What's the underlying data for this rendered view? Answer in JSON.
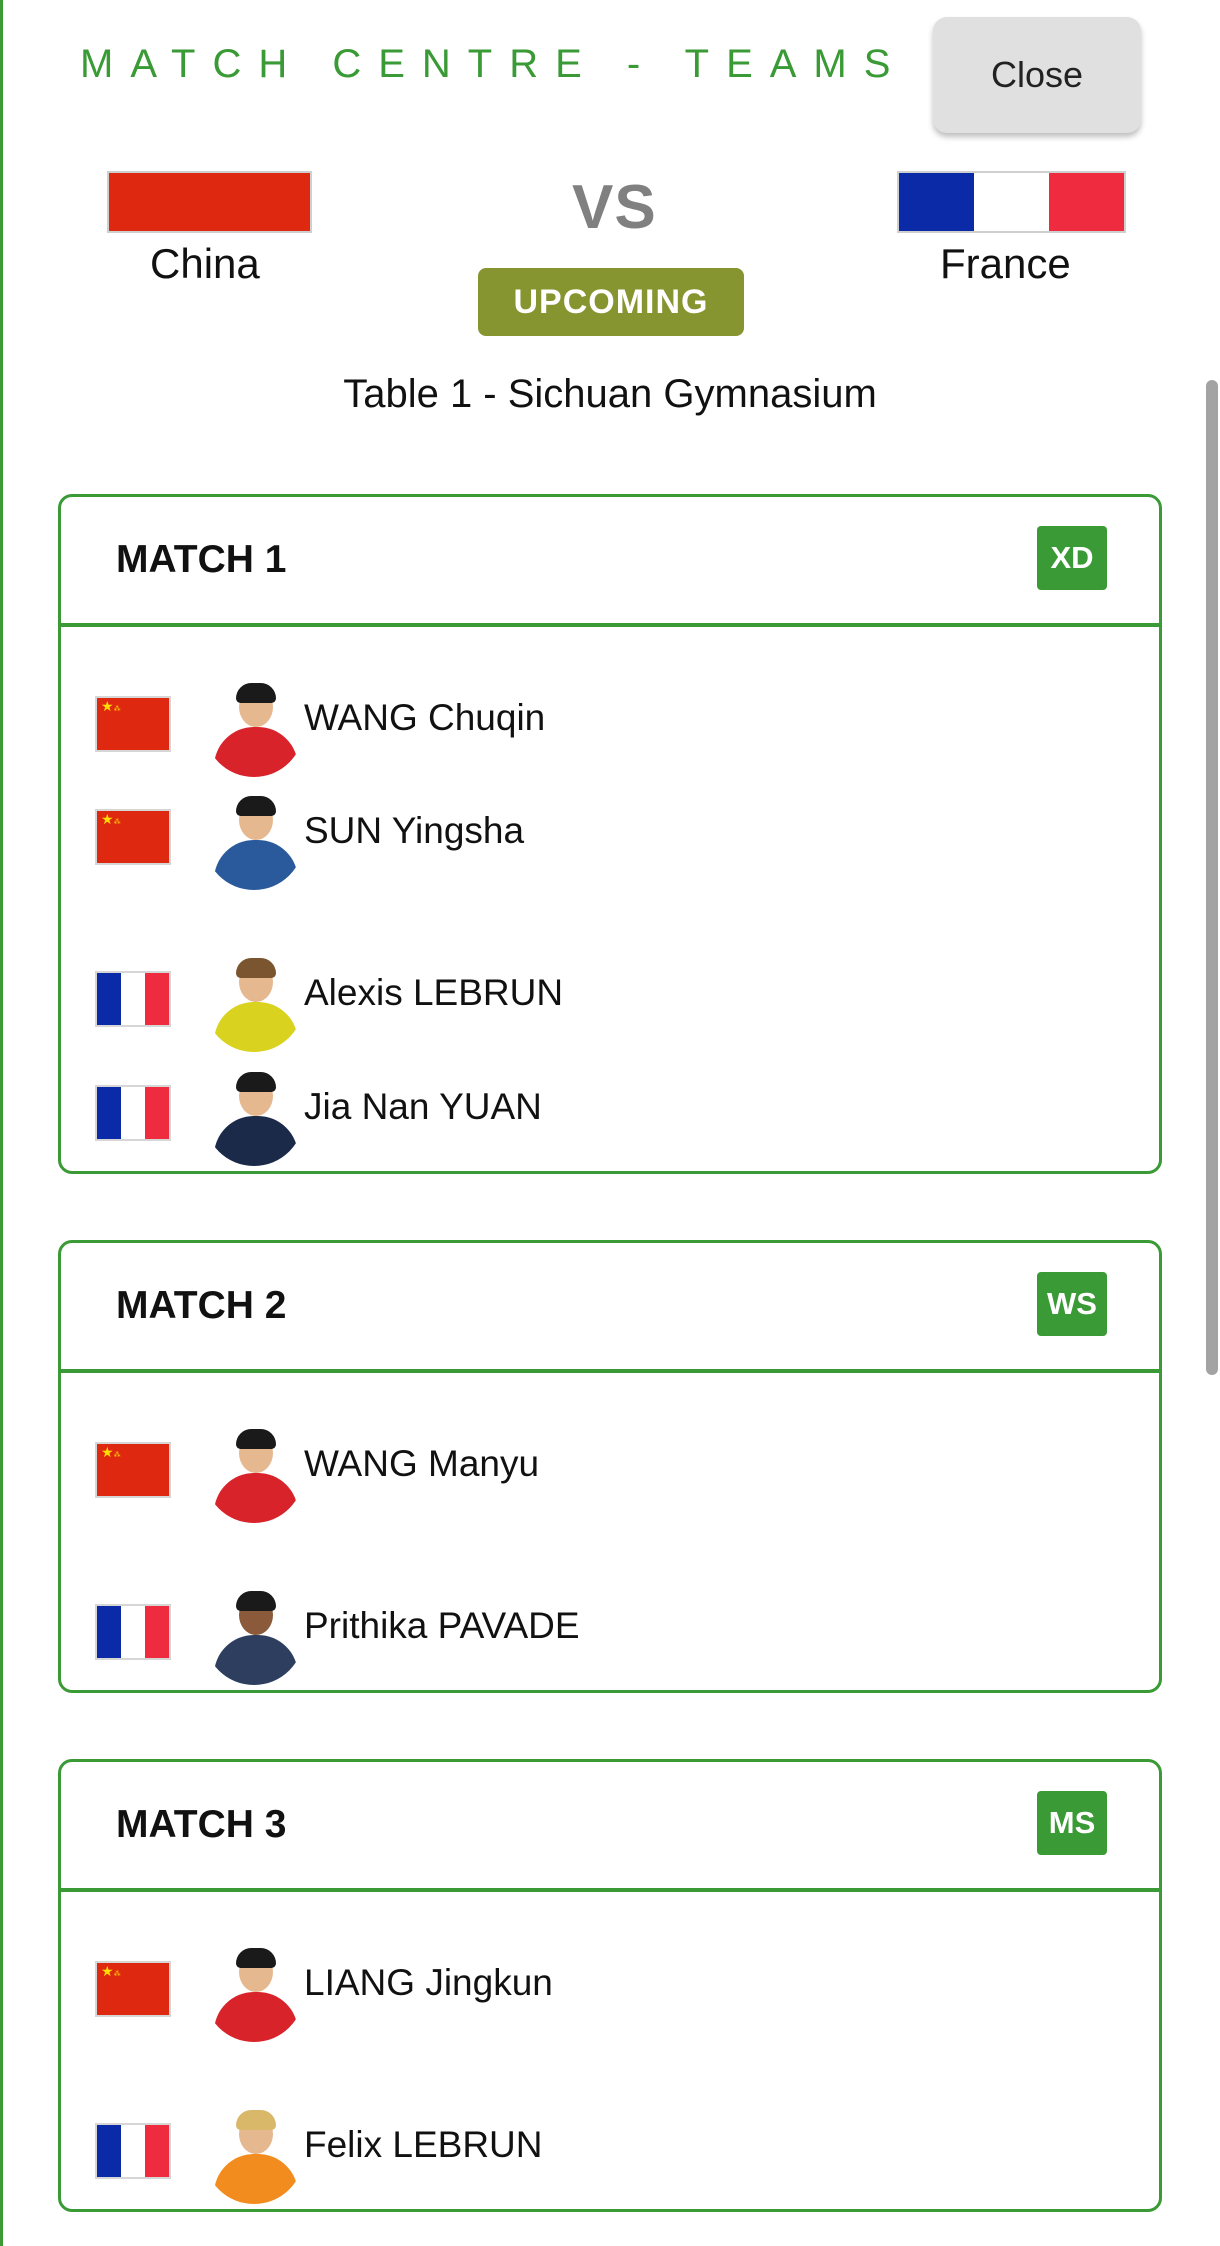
{
  "header": {
    "title": "MATCH CENTRE - TEAMS",
    "close_label": "Close"
  },
  "fixture": {
    "home_team": "China",
    "away_team": "France",
    "vs_label": "VS",
    "status": "UPCOMING",
    "venue": "Table 1 - Sichuan Gymnasium"
  },
  "matches": [
    {
      "title": "MATCH 1",
      "type": "XD",
      "players": [
        {
          "name": "WANG Chuqin",
          "country": "China"
        },
        {
          "name": "SUN Yingsha",
          "country": "China"
        },
        {
          "name": "Alexis LEBRUN",
          "country": "France"
        },
        {
          "name": "Jia Nan YUAN",
          "country": "France"
        }
      ]
    },
    {
      "title": "MATCH 2",
      "type": "WS",
      "players": [
        {
          "name": "WANG Manyu",
          "country": "China"
        },
        {
          "name": "Prithika PAVADE",
          "country": "France"
        }
      ]
    },
    {
      "title": "MATCH 3",
      "type": "MS",
      "players": [
        {
          "name": "LIANG Jingkun",
          "country": "China"
        },
        {
          "name": "Felix LEBRUN",
          "country": "France"
        }
      ]
    }
  ],
  "colors": {
    "accent_green": "#3a9a35",
    "status_olive": "#869530",
    "china_red": "#de2910",
    "france_blue": "#0a2aa8",
    "france_red": "#ef2b3f"
  },
  "icons": {
    "close": "close-button",
    "flag_china": "china-flag-icon",
    "flag_france": "france-flag-icon"
  }
}
